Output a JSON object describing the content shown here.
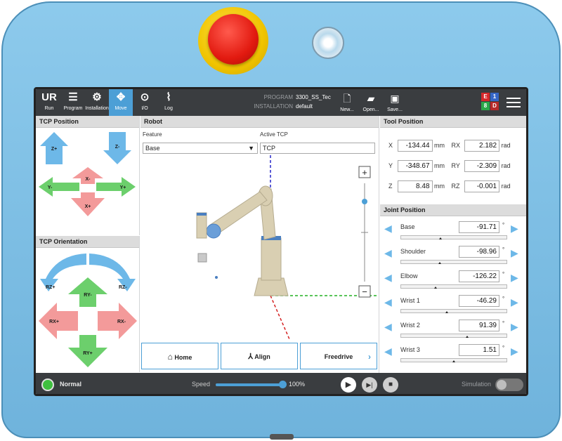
{
  "topbar": {
    "tabs": [
      {
        "label": "Run",
        "icon": "ur-logo-icon"
      },
      {
        "label": "Program",
        "icon": "program-icon"
      },
      {
        "label": "Installation",
        "icon": "installation-icon"
      },
      {
        "label": "Move",
        "icon": "move-icon"
      },
      {
        "label": "I/O",
        "icon": "io-icon"
      },
      {
        "label": "Log",
        "icon": "log-icon"
      }
    ],
    "program_key": "PROGRAM",
    "program_value": "3300_SS_Tec",
    "installation_key": "INSTALLATION",
    "installation_value": "default",
    "actions": [
      {
        "label": "New...",
        "icon": "new-file-icon"
      },
      {
        "label": "Open...",
        "icon": "folder-icon"
      },
      {
        "label": "Save...",
        "icon": "save-icon"
      }
    ],
    "ebd": {
      "e": "E",
      "one": "1",
      "eight": "8",
      "d": "D"
    }
  },
  "tcp_position": {
    "title": "TCP Position",
    "arrows": {
      "zplus": "Z+",
      "zminus": "Z-",
      "xminus": "X-",
      "yminus": "Y-",
      "yplus": "Y+",
      "xplus": "X+"
    }
  },
  "tcp_orientation": {
    "title": "TCP Orientation",
    "arrows": {
      "rzplus": "RZ+",
      "rzminus": "RZ-",
      "ryminus": "RY-",
      "rxplus": "RX+",
      "rxminus": "RX-",
      "ryplus": "RY+"
    }
  },
  "robot": {
    "title": "Robot",
    "feature_label": "Feature",
    "feature_value": "Base",
    "active_tcp_label": "Active TCP",
    "active_tcp_value": "TCP",
    "zoom_in": "+",
    "zoom_out": "−",
    "home_label": "Home",
    "align_label": "Align",
    "freedrive_label": "Freedrive",
    "freedrive_chevron": "›"
  },
  "tool_position": {
    "title": "Tool Position",
    "rows": [
      {
        "axis": "X",
        "value": "-134.44",
        "unit": "mm",
        "raxis": "RX",
        "rvalue": "2.182",
        "runit": "rad"
      },
      {
        "axis": "Y",
        "value": "-348.67",
        "unit": "mm",
        "raxis": "RY",
        "rvalue": "-2.309",
        "runit": "rad"
      },
      {
        "axis": "Z",
        "value": "8.48",
        "unit": "mm",
        "raxis": "RZ",
        "rvalue": "-0.001",
        "runit": "rad"
      }
    ]
  },
  "joint_position": {
    "title": "Joint Position",
    "joints": [
      {
        "name": "Base",
        "value": "-91.71",
        "unit": "°",
        "level": 0.37
      },
      {
        "name": "Shoulder",
        "value": "-98.96",
        "unit": "°",
        "level": 0.36
      },
      {
        "name": "Elbow",
        "value": "-126.22",
        "unit": "°",
        "level": 0.32
      },
      {
        "name": "Wrist 1",
        "value": "-46.29",
        "unit": "°",
        "level": 0.43
      },
      {
        "name": "Wrist 2",
        "value": "91.39",
        "unit": "°",
        "level": 0.63
      },
      {
        "name": "Wrist 3",
        "value": "1.51",
        "unit": "°",
        "level": 0.5
      }
    ]
  },
  "bottom": {
    "status": "Normal",
    "speed_label": "Speed",
    "speed_value": "100%",
    "speed_level": 1.0,
    "simulation_label": "Simulation"
  },
  "colors": {
    "accent": "#4c9fd6",
    "arrow_blue": "#6db8e8",
    "arrow_green": "#6ccf6c",
    "arrow_red": "#f39a9a",
    "status_green": "#3fbf3f",
    "bar": "#3a3d40"
  }
}
